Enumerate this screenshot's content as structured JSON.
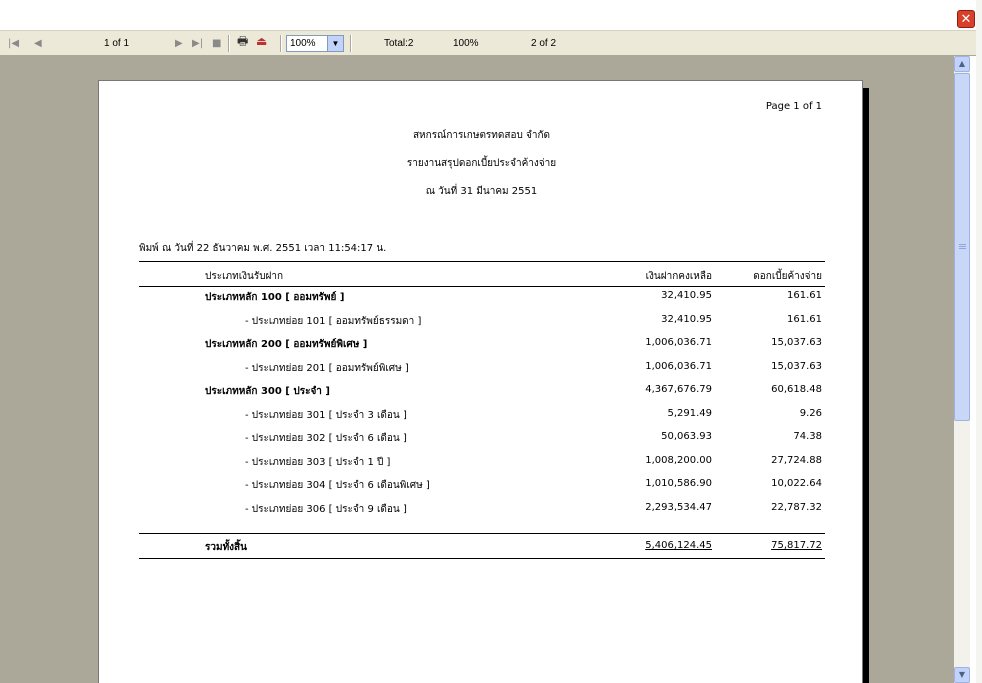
{
  "toolbar": {
    "first_icon": "|◀",
    "prev_icon": "◀",
    "page_indicator": "1 of 1",
    "next_icon": "▶",
    "last_icon": "▶|",
    "stop_icon": "■",
    "print_icon": "printer-icon",
    "export_icon": "export-icon",
    "zoom_value": "100%",
    "total_text": "Total:2",
    "percent_text": "100%",
    "page_count_text": "2 of 2"
  },
  "report": {
    "page_label": "Page 1 of 1",
    "org_name": "สหกรณ์การเกษตรทดสอบ จำกัด",
    "report_title": "รายงานสรุปดอกเบี้ยประจำค้างจ่าย",
    "as_of_date": "ณ วันที่ 31 มีนาคม 2551",
    "printed_on": "พิมพ์ ณ วันที่ 22 ธันวาคม พ.ศ. 2551 เวลา 11:54:17 น.",
    "columns": {
      "type": "ประเภทเงินรับฝาก",
      "balance": "เงินฝากคงเหลือ",
      "interest": "ดอกเบี้ยค้างจ่าย"
    },
    "rows": [
      {
        "label": "ประเภทหลัก 100 [ ออมทรัพย์ ]",
        "balance": "32,410.95",
        "interest": "161.61",
        "level": "main"
      },
      {
        "label": "- ประเภทย่อย  101 [ ออมทรัพย์ธรรมดา ]",
        "balance": "32,410.95",
        "interest": "161.61",
        "level": "sub"
      },
      {
        "label": "ประเภทหลัก 200 [ ออมทรัพย์พิเศษ ]",
        "balance": "1,006,036.71",
        "interest": "15,037.63",
        "level": "main"
      },
      {
        "label": "- ประเภทย่อย  201 [ ออมทรัพย์พิเศษ ]",
        "balance": "1,006,036.71",
        "interest": "15,037.63",
        "level": "sub"
      },
      {
        "label": "ประเภทหลัก 300 [ ประจำ ]",
        "balance": "4,367,676.79",
        "interest": "60,618.48",
        "level": "main"
      },
      {
        "label": "- ประเภทย่อย  301 [ ประจำ 3 เดือน ]",
        "balance": "5,291.49",
        "interest": "9.26",
        "level": "sub"
      },
      {
        "label": "- ประเภทย่อย  302 [ ประจำ 6 เดือน ]",
        "balance": "50,063.93",
        "interest": "74.38",
        "level": "sub"
      },
      {
        "label": "- ประเภทย่อย  303 [ ประจำ 1 ปี ]",
        "balance": "1,008,200.00",
        "interest": "27,724.88",
        "level": "sub"
      },
      {
        "label": "- ประเภทย่อย  304 [ ประจำ 6 เดือนพิเศษ ]",
        "balance": "1,010,586.90",
        "interest": "10,022.64",
        "level": "sub"
      },
      {
        "label": "- ประเภทย่อย  306 [ ประจำ 9 เดือน ]",
        "balance": "2,293,534.47",
        "interest": "22,787.32",
        "level": "sub"
      }
    ],
    "total": {
      "label": "รวมทั้งสิ้น",
      "balance": "5,406,124.45",
      "interest": "75,817.72"
    }
  },
  "icons": {
    "close": "close-icon",
    "scroll_up": "scroll-up-icon",
    "scroll_down": "scroll-down-icon"
  }
}
